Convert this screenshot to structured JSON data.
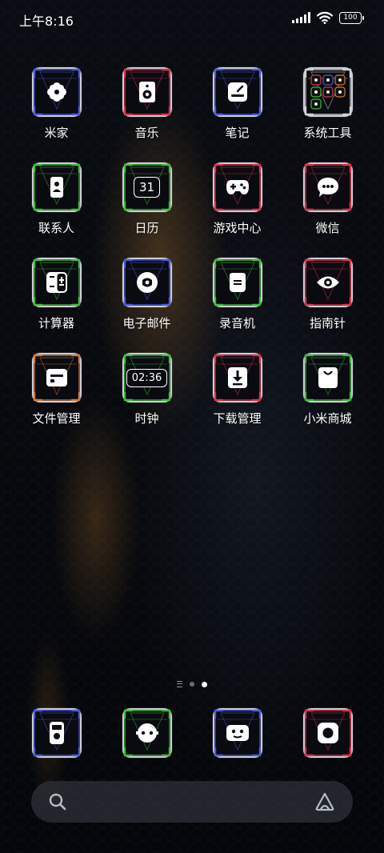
{
  "status_bar": {
    "time": "上午8:16",
    "battery": "100"
  },
  "apps": [
    {
      "id": "mijia",
      "label": "米家",
      "icon": "flower-icon",
      "color": "#4a5ad8"
    },
    {
      "id": "music",
      "label": "音乐",
      "icon": "speaker-icon",
      "color": "#d8324e"
    },
    {
      "id": "notes",
      "label": "笔记",
      "icon": "note-icon",
      "color": "#4a5ad8"
    },
    {
      "id": "tools",
      "label": "系统工具",
      "icon": "folder-grid-icon",
      "color": "#cfcfd6"
    },
    {
      "id": "contacts",
      "label": "联系人",
      "icon": "contact-icon",
      "color": "#3cbb3c"
    },
    {
      "id": "calendar",
      "label": "日历",
      "icon": "calendar-icon",
      "color": "#3cbb3c",
      "text": "31"
    },
    {
      "id": "games",
      "label": "游戏中心",
      "icon": "gamepad-icon",
      "color": "#d8324e"
    },
    {
      "id": "wechat",
      "label": "微信",
      "icon": "chat-bubble-icon",
      "color": "#d8324e"
    },
    {
      "id": "calculator",
      "label": "计算器",
      "icon": "calculator-icon",
      "color": "#3cbb3c"
    },
    {
      "id": "email",
      "label": "电子邮件",
      "icon": "mail-icon",
      "color": "#4a5ad8"
    },
    {
      "id": "recorder",
      "label": "录音机",
      "icon": "recorder-icon",
      "color": "#3cbb3c"
    },
    {
      "id": "compass",
      "label": "指南针",
      "icon": "compass-icon",
      "color": "#d8324e"
    },
    {
      "id": "files",
      "label": "文件管理",
      "icon": "file-manager-icon",
      "color": "#d07a3a"
    },
    {
      "id": "clock",
      "label": "时钟",
      "icon": "clock-icon",
      "color": "#3cbb3c",
      "text": "02:36"
    },
    {
      "id": "downloads",
      "label": "下载管理",
      "icon": "download-icon",
      "color": "#d8324e"
    },
    {
      "id": "mistore",
      "label": "小米商城",
      "icon": "shopping-bag-icon",
      "color": "#3cbb3c"
    }
  ],
  "dock": [
    {
      "id": "phone",
      "icon": "phone-icon",
      "color": "#4a5ad8"
    },
    {
      "id": "messages",
      "icon": "message-icon",
      "color": "#3cbb3c"
    },
    {
      "id": "browser",
      "icon": "browser-icon",
      "color": "#4a5ad8"
    },
    {
      "id": "camera",
      "icon": "camera-icon",
      "color": "#d8324e"
    }
  ],
  "page_indicator": {
    "pages": 3,
    "current": 3
  },
  "search_bar": {
    "left_icon": "search-icon",
    "right_icon": "assistant-icon"
  }
}
